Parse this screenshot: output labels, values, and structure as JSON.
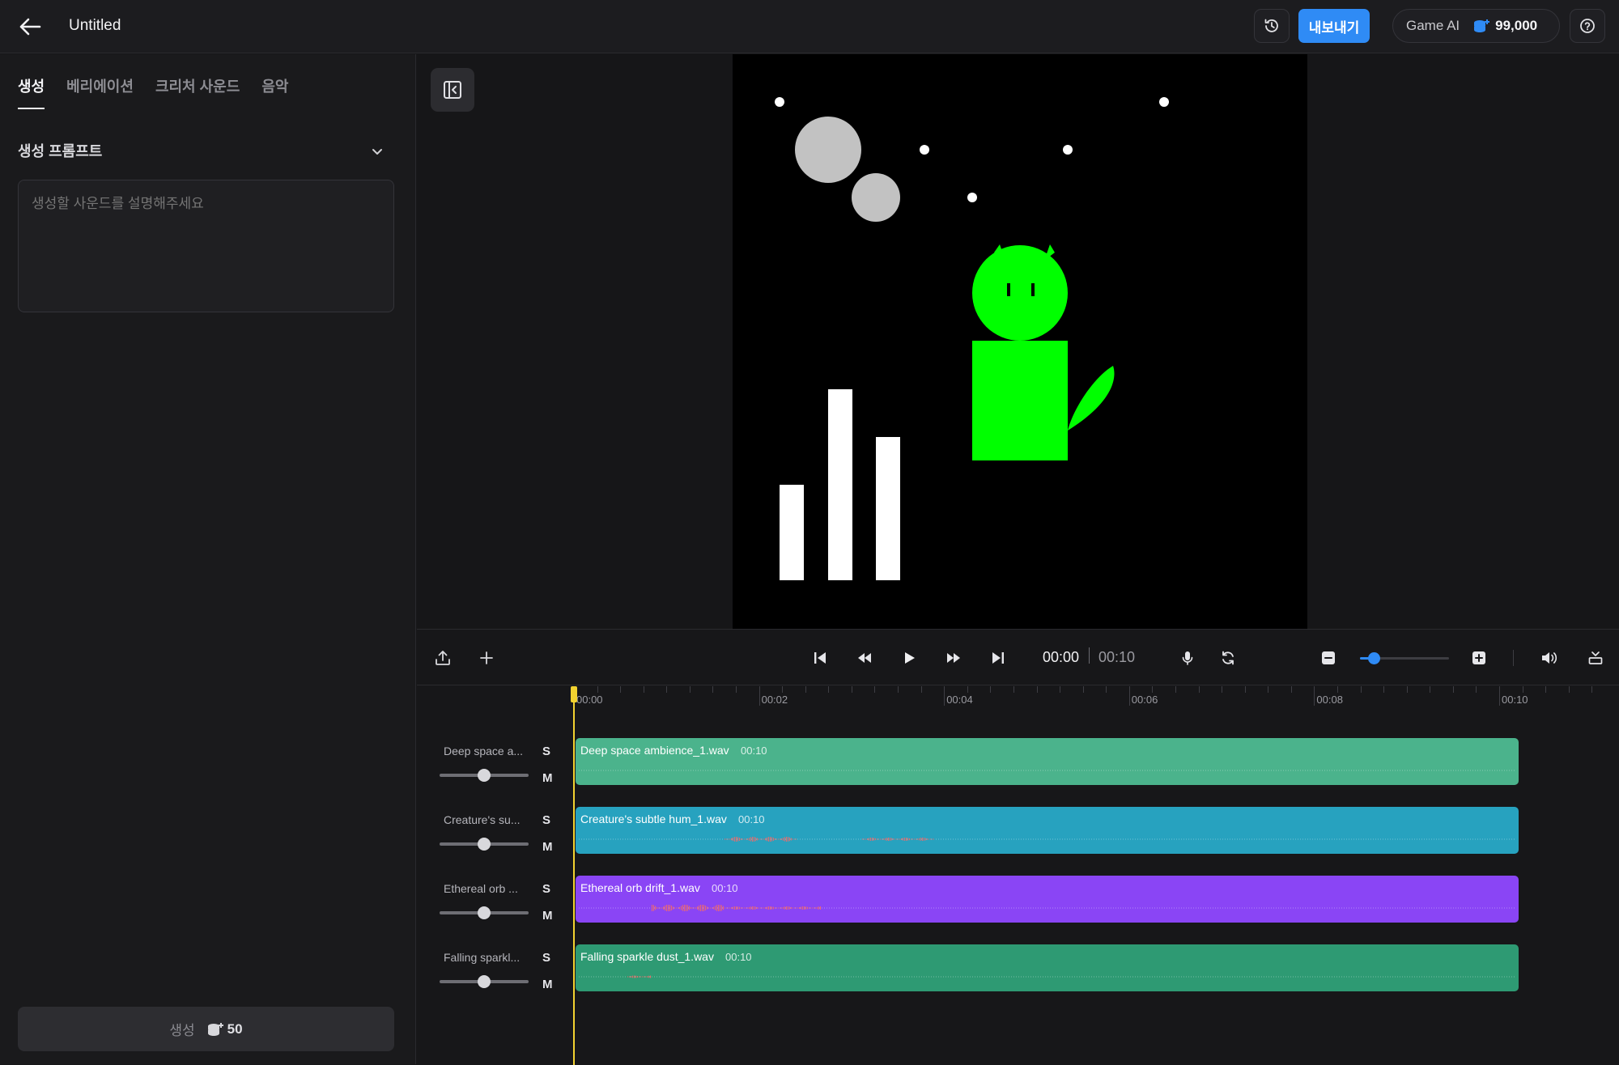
{
  "header": {
    "back_icon": "arrow-left-icon",
    "title": "Untitled",
    "history_icon": "history-icon",
    "export_label": "내보내기",
    "account_name": "Game AI",
    "credits": "99,000",
    "help_icon": "help-icon"
  },
  "left_panel": {
    "tabs": [
      "생성",
      "베리에이션",
      "크리처 사운드",
      "음악"
    ],
    "active_tab": "생성",
    "section_title": "생성 프롬프트",
    "prompt_placeholder": "생성할 사운드를 설명해주세요",
    "generate_label": "생성",
    "generate_cost": "50"
  },
  "transport": {
    "current_time": "00:00",
    "total_time": "00:10",
    "zoom_level": 0.15
  },
  "ruler": {
    "labels": [
      "00:00",
      "00:02",
      "00:04",
      "00:06",
      "00:08",
      "00:10"
    ]
  },
  "tracks": [
    {
      "label": "Deep space a...",
      "clip_name": "Deep space ambience_1.wav",
      "duration": "00:10",
      "color": "#4bb38c",
      "volume": 0.5
    },
    {
      "label": "Creature's su...",
      "clip_name": "Creature's subtle hum_1.wav",
      "duration": "00:10",
      "color": "#27a2bf",
      "volume": 0.5
    },
    {
      "label": "Ethereal orb ...",
      "clip_name": "Ethereal orb drift_1.wav",
      "duration": "00:10",
      "color": "#8a45f5",
      "volume": 0.5
    },
    {
      "label": "Falling sparkl...",
      "clip_name": "Falling sparkle dust_1.wav",
      "duration": "00:10",
      "color": "#2e9a73",
      "volume": 0.5
    }
  ],
  "solo_label": "S",
  "mute_label": "M",
  "colors": {
    "accent": "#2f8bf5",
    "playhead": "#f2d230",
    "creature": "#00ff00"
  }
}
